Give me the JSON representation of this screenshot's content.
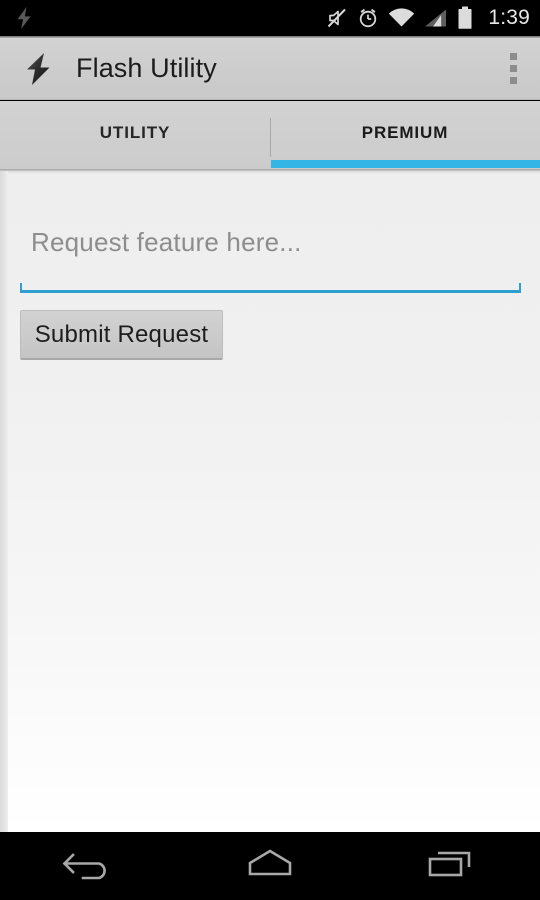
{
  "status_bar": {
    "time": "1:39",
    "icons": [
      {
        "name": "flash-notification-icon",
        "label": "flash"
      },
      {
        "name": "mute-icon",
        "label": "silent mode"
      },
      {
        "name": "alarm-clock-icon",
        "label": "alarm set"
      },
      {
        "name": "wifi-icon",
        "label": "wifi"
      },
      {
        "name": "cellular-signal-icon",
        "label": "signal"
      },
      {
        "name": "battery-icon",
        "label": "battery full"
      }
    ],
    "background": "#000000",
    "text_color": "#e8e8e8"
  },
  "action_bar": {
    "title": "Flash Utility",
    "app_icon": "lightning-bolt-icon",
    "overflow_icon": "overflow-menu-icon",
    "background": "#cfcfcf"
  },
  "tabs": {
    "items": [
      {
        "label": "UTILITY",
        "selected": false
      },
      {
        "label": "PREMIUM",
        "selected": true
      }
    ],
    "indicator_color": "#33b5e5"
  },
  "content": {
    "request_input": {
      "value": "",
      "placeholder": "Request feature here...",
      "underline_color": "#2d9fd0",
      "focused": true
    },
    "submit_button": {
      "label": "Submit Request"
    }
  },
  "nav_bar": {
    "buttons": [
      {
        "name": "back-button",
        "label": "Back"
      },
      {
        "name": "home-button",
        "label": "Home"
      },
      {
        "name": "recents-button",
        "label": "Recent apps"
      }
    ],
    "background": "#000000"
  }
}
